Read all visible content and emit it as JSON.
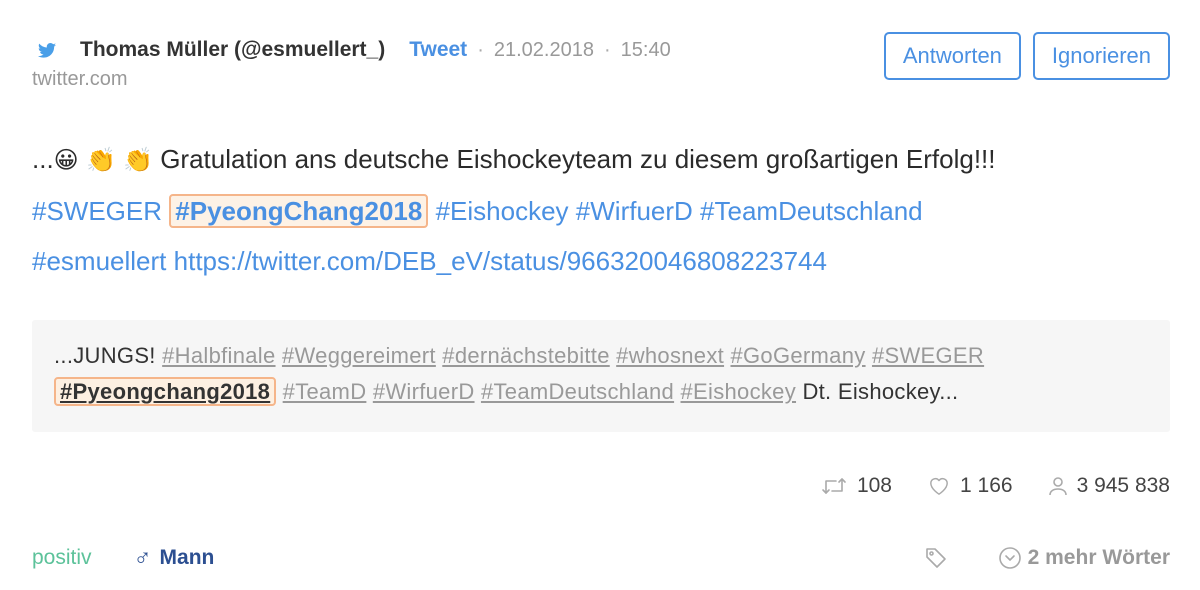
{
  "header": {
    "author": "Thomas Müller (@esmuellert_)",
    "type": "Tweet",
    "date": "21.02.2018",
    "time": "15:40",
    "separator": "·",
    "source": "twitter.com"
  },
  "actions": {
    "reply": "Antworten",
    "ignore": "Ignorieren"
  },
  "tweet": {
    "prefix": "...",
    "emoji_1": "😀",
    "emoji_2": "👏",
    "emoji_3": "👏",
    "text": "Gratulation ans deutsche Eishockeyteam zu diesem großartigen Erfolg!!!",
    "tag_1": "#SWEGER",
    "tag_highlight": "#PyeongChang2018",
    "tag_2": "#Eishockey",
    "tag_3": "#WirfuerD",
    "tag_4": "#TeamDeutschland",
    "tag_5": "#esmuellert",
    "url": "https://twitter.com/DEB_eV/status/966320046808223744"
  },
  "quote": {
    "prefix": "...JUNGS!",
    "tags_line1": [
      "#Halbfinale",
      "#Weggereimert",
      "#dernächstebitte",
      "#whosnext",
      "#GoGermany",
      "#SWEGER"
    ],
    "tag_highlight": "#Pyeongchang2018",
    "tags_line2": [
      "#TeamD",
      "#WirfuerD",
      "#TeamDeutschland",
      "#Eishockey"
    ],
    "suffix": "Dt. Eishockey..."
  },
  "stats": {
    "retweets": "108",
    "likes": "1 166",
    "reach": "3 945 838"
  },
  "footer": {
    "sentiment": "positiv",
    "gender_symbol": "♂",
    "gender": "Mann",
    "more_words": "2 mehr Wörter"
  },
  "colors": {
    "accent": "#4a90e2",
    "positive": "#5cc29a",
    "gender": "#2c4f91",
    "highlight_border": "#f5b58a"
  },
  "icons": {
    "source": "twitter-bird-icon",
    "retweets": "retweet-icon",
    "likes": "heart-icon",
    "reach": "user-icon",
    "tag": "tag-icon",
    "more": "chevron-circle-down-icon"
  }
}
